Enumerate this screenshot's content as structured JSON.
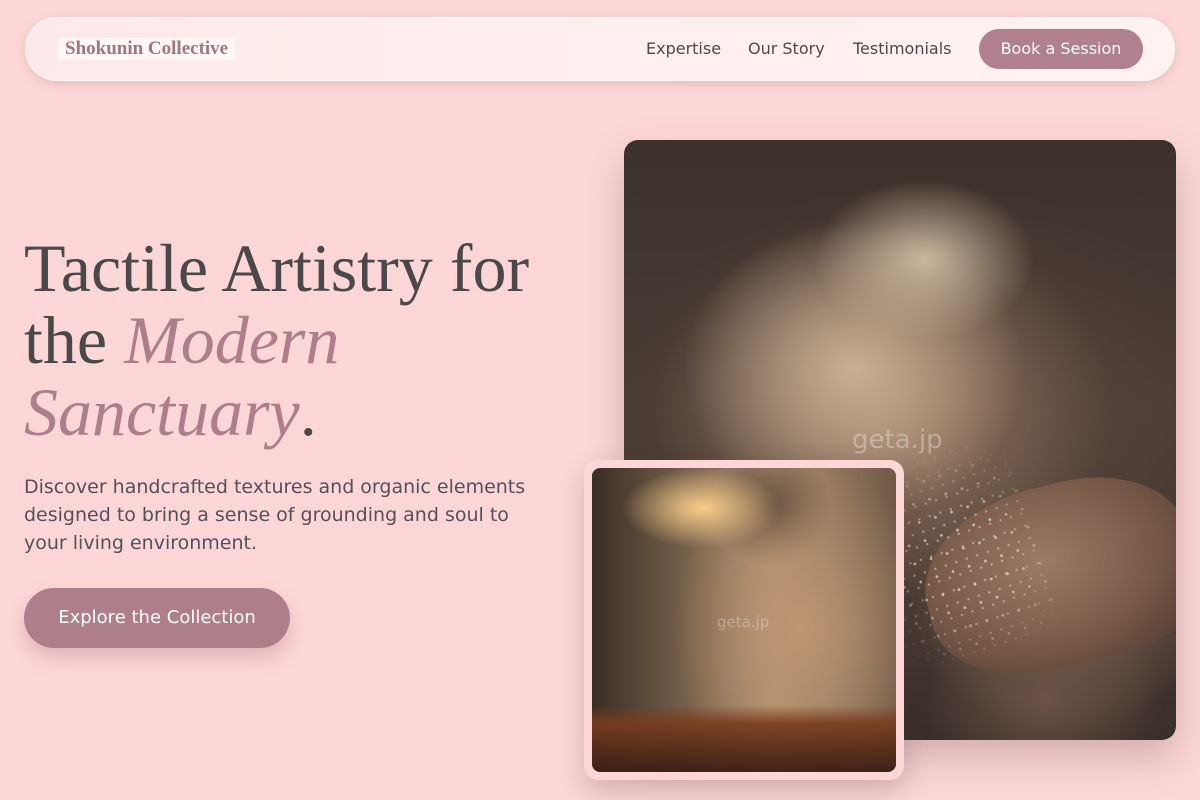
{
  "brand": {
    "name": "Shokunin Collective"
  },
  "nav": {
    "links": [
      "Expertise",
      "Our Story",
      "Testimonials"
    ],
    "cta": "Book a Session"
  },
  "hero": {
    "headline_part1": "Tactile Artistry for the ",
    "headline_emphasis": "Modern Sanctuary",
    "headline_end": ".",
    "description": "Discover handcrafted textures and organic elements designed to bring a sense of grounding and soul to your living environment.",
    "button": "Explore the Collection"
  },
  "images": {
    "main_watermark": "geta.jp",
    "inset_watermark": "geta.jp"
  },
  "colors": {
    "background": "#fdd7d7",
    "accent": "#ae7e8b",
    "text_dark": "#4b4849"
  }
}
